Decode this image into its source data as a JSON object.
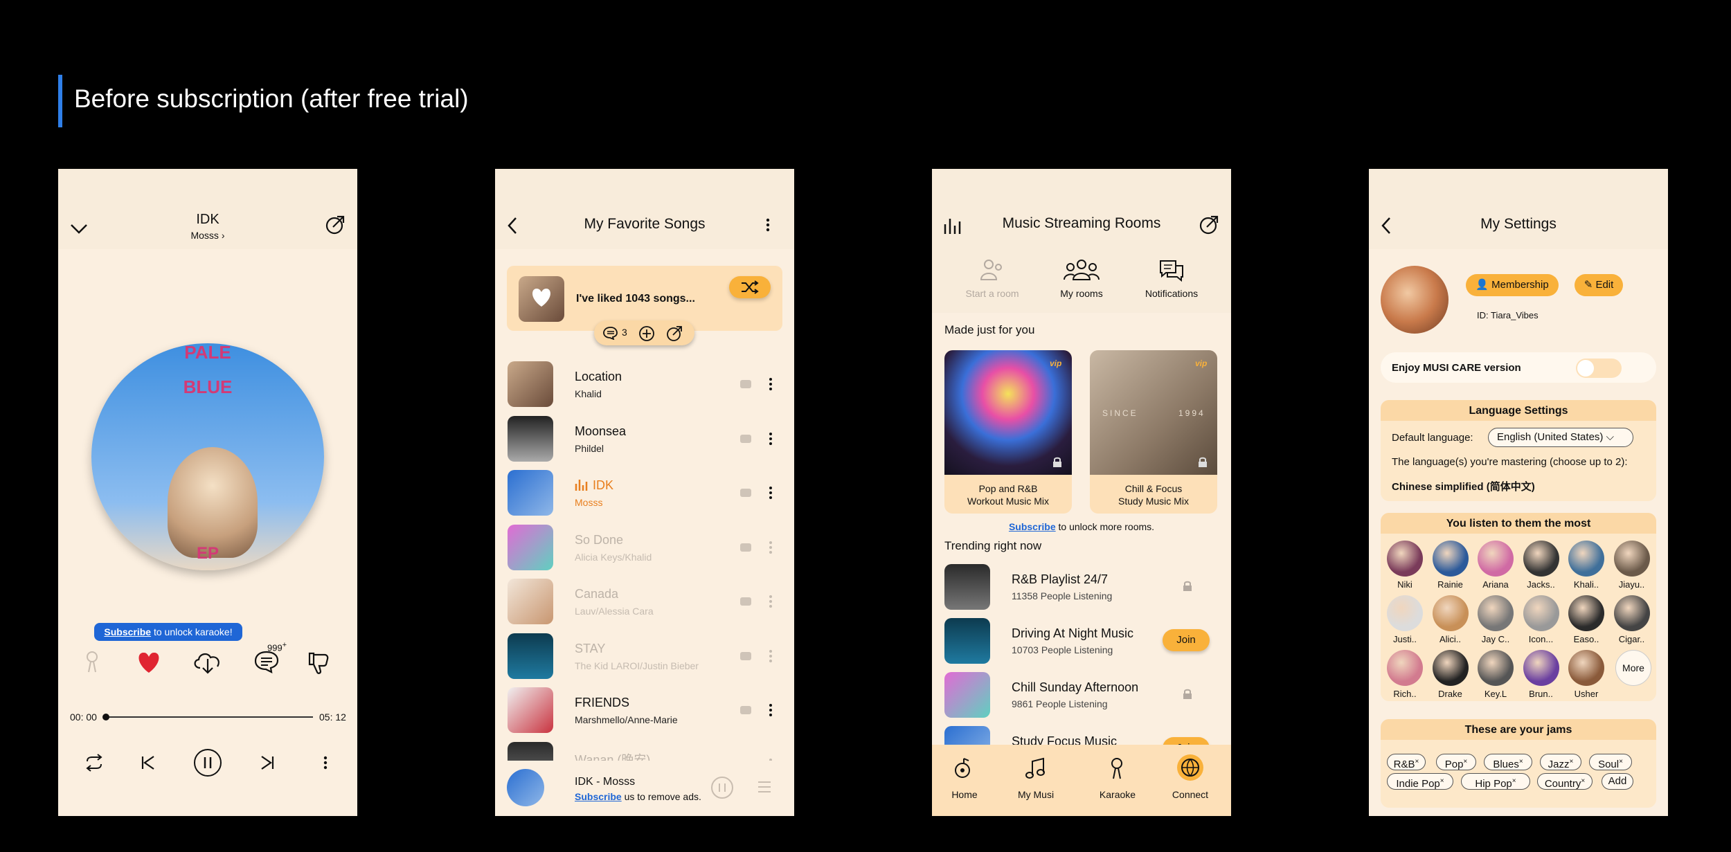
{
  "page": {
    "title": "Before subscription (after free trial)",
    "accent": "#2f7fe8"
  },
  "colors": {
    "background": "#000000",
    "phone_bg": "#fbefe0",
    "orange": "#f9b13a",
    "active": "#e87e1d",
    "blue": "#1f66d6"
  },
  "player": {
    "song": "IDK",
    "artist": "Mosss",
    "cover_text": [
      "PALE",
      "BLUE",
      "EP"
    ],
    "banner": {
      "link": "Subscribe",
      "text": "to unlock karaoke!"
    },
    "comments_badge": "999",
    "comments_badge_sup": "+",
    "time_current": "00: 00",
    "time_total": "05: 12",
    "progress": 0.0,
    "icons": [
      "chevron-down-icon",
      "share-icon",
      "microphone-icon",
      "heart-icon",
      "download-icon",
      "comment-icon",
      "thumbs-down-icon",
      "repeat-icon",
      "previous-icon",
      "pause-icon",
      "next-icon",
      "more-icon"
    ]
  },
  "favorites": {
    "title": "My Favorite Songs",
    "liked_text": "I've liked 1043 songs...",
    "comment_count": "3",
    "songs": [
      {
        "title": "Location",
        "artist": "Khalid",
        "state": "normal"
      },
      {
        "title": "Moonsea",
        "artist": "Phildel",
        "state": "normal"
      },
      {
        "title": "IDK",
        "artist": "Mosss",
        "state": "playing"
      },
      {
        "title": "So Done",
        "artist": "Alicia Keys/Khalid",
        "state": "disabled"
      },
      {
        "title": "Canada",
        "artist": "Lauv/Alessia Cara",
        "state": "disabled"
      },
      {
        "title": "STAY",
        "artist": "The Kid LAROI/Justin Bieber",
        "state": "disabled"
      },
      {
        "title": "FRIENDS",
        "artist": "Marshmello/Anne-Marie",
        "state": "normal"
      },
      {
        "title": "Wanan (晚安)",
        "artist": "",
        "state": "disabled"
      }
    ],
    "mini": {
      "title": "IDK - Mosss",
      "link": "Subscribe",
      "text": "us to remove ads."
    }
  },
  "rooms": {
    "title": "Music Streaming Rooms",
    "tabs": [
      {
        "label": "Start a room",
        "disabled": true
      },
      {
        "label": "My rooms",
        "disabled": false
      },
      {
        "label": "Notifications",
        "disabled": false
      }
    ],
    "made_header": "Made just for you",
    "mixes": [
      {
        "line1": "Pop and R&B",
        "line2": "Workout Music Mix"
      },
      {
        "line1": "Chill & Focus",
        "line2": "Study Music Mix"
      }
    ],
    "vip": "vip",
    "mix2_art": "SINCE",
    "mix2_art2": "1994",
    "subscribe": {
      "link": "Subscribe",
      "text": "to unlock more rooms."
    },
    "trending_header": "Trending right now",
    "trending": [
      {
        "title": "R&B Playlist 24/7",
        "sub": "11358 People Listening",
        "action": "lock"
      },
      {
        "title": "Driving At Night Music",
        "sub": "10703 People Listening",
        "action": "Join"
      },
      {
        "title": "Chill Sunday Afternoon",
        "sub": "9861 People Listening",
        "action": "lock"
      },
      {
        "title": "Study Focus Music",
        "sub": "",
        "action": "Join"
      }
    ],
    "nav": [
      "Home",
      "My Musi",
      "Karaoke",
      "Connect"
    ]
  },
  "settings": {
    "title": "My Settings",
    "membership": "Membership",
    "edit": "Edit",
    "id": "ID: Tiara_Vibes",
    "care_label": "Enjoy MUSI CARE version",
    "care_on": false,
    "lang_header": "Language Settings",
    "default_label": "Default language:",
    "default_value": "English (United States)",
    "mastering": "The language(s) you're mastering (choose up to 2):",
    "mastering_value": "Chinese simplified (简体中文)",
    "listen_header": "You listen to them the most",
    "artists": [
      "Niki",
      "Rainie",
      "Ariana",
      "Jacks..",
      "Khali..",
      "Jiayu..",
      "Justi..",
      "Alici..",
      "Jay C..",
      "Icon...",
      "Easo..",
      "Cigar..",
      "Rich..",
      "Drake",
      "Key.L",
      "Brun..",
      "Usher"
    ],
    "more": "More",
    "jams_header": "These are your jams",
    "jams": [
      "R&B",
      "Pop",
      "Blues",
      "Jazz",
      "Soul",
      "Indie Pop",
      "Hip Pop",
      "Country"
    ],
    "add": "Add"
  }
}
